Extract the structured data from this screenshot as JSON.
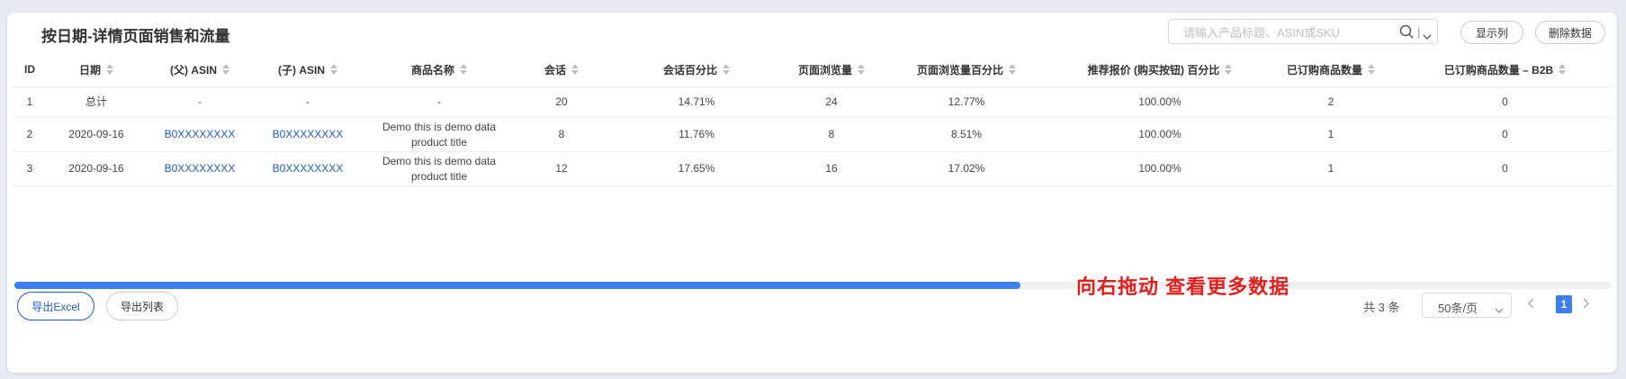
{
  "page": {
    "title": "按日期-详情页面销售和流量"
  },
  "toolbar": {
    "search_placeholder": "请输入产品标题、ASIN或SKU",
    "search_divider": "|",
    "show_columns_label": "显示列",
    "delete_data_label": "删除数据"
  },
  "table": {
    "headers": [
      "ID",
      "日期",
      "(父) ASIN",
      "(子) ASIN",
      "商品名称",
      "会话",
      "会话百分比",
      "页面浏览量",
      "页面浏览量百分比",
      "推荐报价 (购买按钮) 百分比",
      "已订购商品数量",
      "已订购商品数量 – B2B"
    ],
    "rows": [
      [
        "1",
        "总计",
        "-",
        "-",
        "-",
        "20",
        "14.71%",
        "24",
        "12.77%",
        "100.00%",
        "2",
        "0"
      ],
      [
        "2",
        "2020-09-16",
        "B0XXXXXXXX",
        "B0XXXXXXXX",
        "Demo this is demo data product title",
        "8",
        "11.76%",
        "8",
        "8.51%",
        "100.00%",
        "1",
        "0"
      ],
      [
        "3",
        "2020-09-16",
        "B0XXXXXXXX",
        "B0XXXXXXXX",
        "Demo this is demo data product title",
        "12",
        "17.65%",
        "16",
        "17.02%",
        "100.00%",
        "1",
        "0"
      ]
    ]
  },
  "scroll": {
    "hint": "向右拖动 查看更多数据",
    "thumb_fraction": 0.63
  },
  "footer": {
    "export_excel_label": "导出Excel",
    "export_list_label": "导出列表",
    "total_label": "共 3 条",
    "page_size_label": "50条/页",
    "current_page": "1"
  },
  "colors": {
    "accent": "#3a7ef0",
    "link": "#1f5bc9",
    "hint": "#e0201e"
  },
  "icons": {
    "search": "search-icon",
    "chevron": "chevron-down-icon",
    "prev": "chevron-left-icon",
    "next": "chevron-right-icon",
    "sort": "sort-icon"
  }
}
